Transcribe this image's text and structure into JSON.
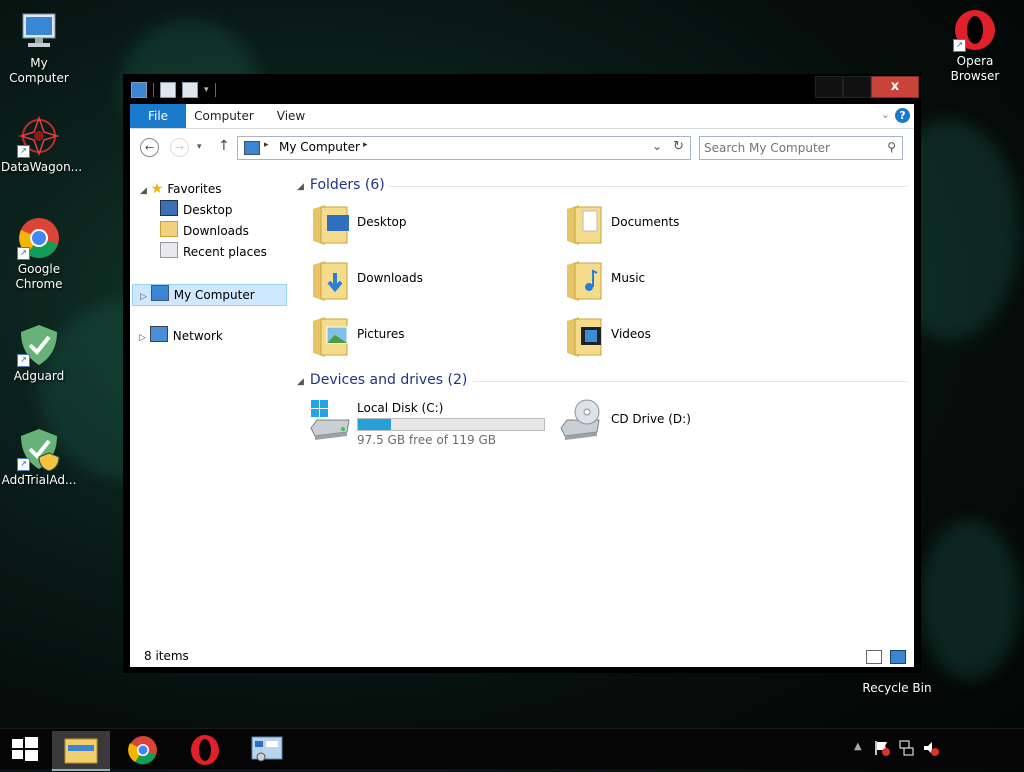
{
  "desktop": {
    "icons": [
      {
        "label": "My Computer"
      },
      {
        "label": "DataWagon..."
      },
      {
        "label": "Google Chrome"
      },
      {
        "label": "Adguard"
      },
      {
        "label": "AddTrialAd..."
      },
      {
        "label": "Opera Browser"
      },
      {
        "label": "Recycle Bin"
      }
    ]
  },
  "window": {
    "close_label": "x",
    "ribbon_tabs": [
      {
        "label": "File"
      },
      {
        "label": "Computer"
      },
      {
        "label": "View"
      }
    ],
    "address": {
      "crumb": "My Computer"
    },
    "search": {
      "placeholder": "Search My Computer"
    },
    "nav": {
      "favorites": "Favorites",
      "desktop": "Desktop",
      "downloads": "Downloads",
      "recent": "Recent places",
      "my_computer": "My Computer",
      "network": "Network"
    },
    "folders_header": "Folders (6)",
    "folders": [
      {
        "label": "Desktop"
      },
      {
        "label": "Documents"
      },
      {
        "label": "Downloads"
      },
      {
        "label": "Music"
      },
      {
        "label": "Pictures"
      },
      {
        "label": "Videos"
      }
    ],
    "drives_header": "Devices and drives (2)",
    "drives": [
      {
        "label": "Local Disk (C:)",
        "free": "97.5 GB free of 119 GB",
        "used_fraction": 0.18
      },
      {
        "label": "CD Drive (D:)"
      }
    ],
    "status": "8 items"
  },
  "colors": {
    "accent": "#1979ca",
    "heading": "#1e3287",
    "close": "#c8433a",
    "drive_bar": "#26a0da"
  }
}
